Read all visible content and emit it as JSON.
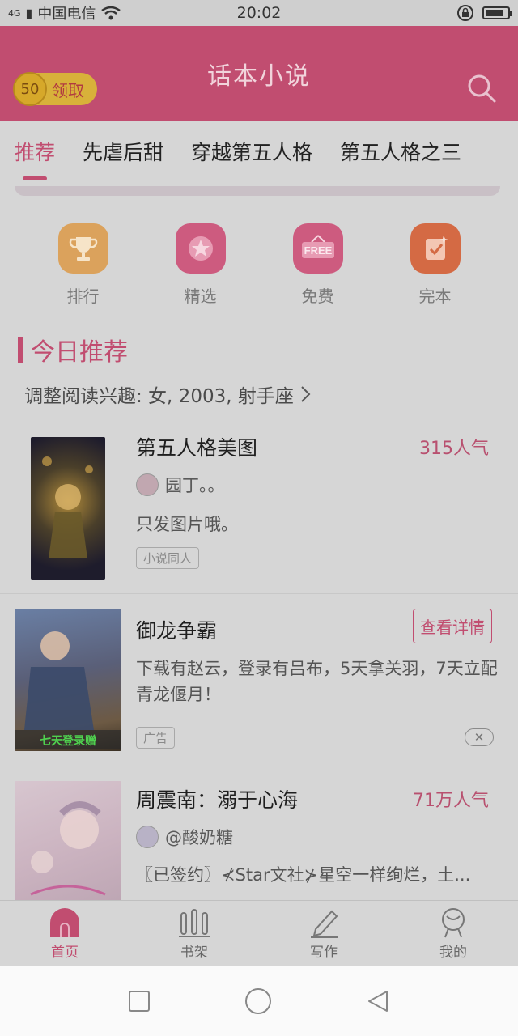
{
  "status_bar": {
    "network": "4G",
    "carrier": "中国电信",
    "time": "20:02",
    "battery_level": 0.85
  },
  "header": {
    "coins": "50",
    "claim_label": "领取",
    "title": "话本小说"
  },
  "tabs": [
    {
      "label": "推荐",
      "active": true
    },
    {
      "label": "先虐后甜",
      "active": false
    },
    {
      "label": "穿越第五人格",
      "active": false
    },
    {
      "label": "第五人格之三",
      "active": false
    }
  ],
  "quick_links": [
    {
      "label": "排行",
      "icon": "trophy-icon",
      "color": "#dba25c"
    },
    {
      "label": "精选",
      "icon": "star-icon",
      "color": "#cd5b7f"
    },
    {
      "label": "免费",
      "icon": "free-icon",
      "color": "#cd5b7f"
    },
    {
      "label": "完本",
      "icon": "check-icon",
      "color": "#d46a44"
    }
  ],
  "section": {
    "title": "今日推荐",
    "interest_line": "调整阅读兴趣: 女, 2003, 射手座"
  },
  "books": [
    {
      "title": "第五人格美图",
      "popularity": "315人气",
      "author": "园丁。。",
      "description": "只发图片哦。",
      "tag": "小说同人"
    },
    {
      "title": "御龙争霸",
      "button": "查看详情",
      "description": "下载有赵云，登录有吕布，5天拿关羽，7天立配青龙偃月！",
      "tag": "广告",
      "cover_caption": "七天登录赠",
      "close_symbol": "✕"
    },
    {
      "title": "周震南：溺于心海",
      "popularity": "71万人气",
      "author": "@酸奶糖",
      "description": "〖已签约〗⊀Star文社⊁星空一样绚烂，土..."
    }
  ],
  "bottom_nav": [
    {
      "label": "首页",
      "icon": "home-icon",
      "active": true
    },
    {
      "label": "书架",
      "icon": "bookshelf-icon",
      "active": false
    },
    {
      "label": "写作",
      "icon": "pen-icon",
      "active": false
    },
    {
      "label": "我的",
      "icon": "profile-icon",
      "active": false
    }
  ],
  "colors": {
    "brand": "#c14d70",
    "overlay_bg": "#d6d6d6"
  }
}
